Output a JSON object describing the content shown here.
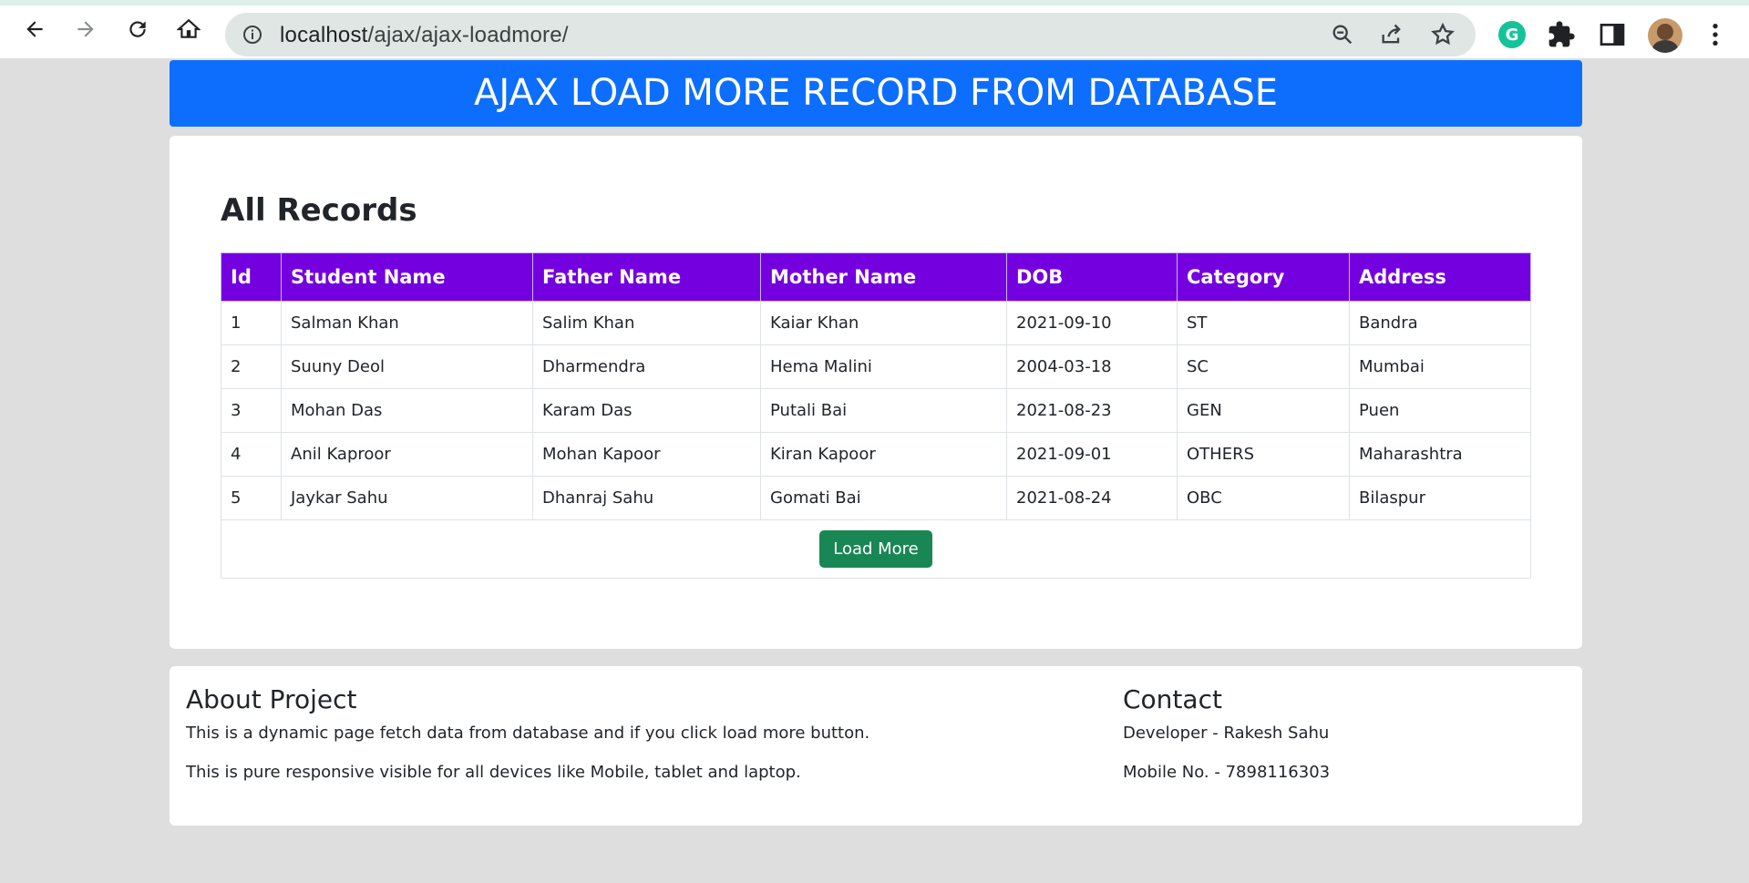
{
  "browser": {
    "url_host": "localhost",
    "url_path": "/ajax/ajax-loadmore/"
  },
  "header": {
    "title": "AJAX LOAD MORE RECORD FROM DATABASE"
  },
  "records": {
    "title": "All Records",
    "columns": [
      "Id",
      "Student Name",
      "Father Name",
      "Mother Name",
      "DOB",
      "Category",
      "Address"
    ],
    "rows": [
      [
        "1",
        "Salman Khan",
        "Salim Khan",
        "Kaiar Khan",
        "2021-09-10",
        "ST",
        "Bandra"
      ],
      [
        "2",
        "Suuny Deol",
        "Dharmendra",
        "Hema Malini",
        "2004-03-18",
        "SC",
        "Mumbai"
      ],
      [
        "3",
        "Mohan Das",
        "Karam Das",
        "Putali Bai",
        "2021-08-23",
        "GEN",
        "Puen"
      ],
      [
        "4",
        "Anil Kaproor",
        "Mohan Kapoor",
        "Kiran Kapoor",
        "2021-09-01",
        "OTHERS",
        "Maharashtra"
      ],
      [
        "5",
        "Jaykar Sahu",
        "Dhanraj Sahu",
        "Gomati Bai",
        "2021-08-24",
        "OBC",
        "Bilaspur"
      ]
    ],
    "load_more_label": "Load More"
  },
  "footer": {
    "about_title": "About Project",
    "about_line1": "This is a dynamic page fetch data from database and if you click load more button.",
    "about_line2": "This is pure responsive visible for all devices like Mobile, tablet and laptop.",
    "contact_title": "Contact",
    "contact_developer": "Developer - Rakesh Sahu",
    "contact_mobile": "Mobile No. - 7898116303"
  },
  "colors": {
    "header_bg": "#0d6efd",
    "table_header_bg": "#7400e0",
    "load_button_bg": "#198754",
    "page_bg": "#dedede"
  }
}
